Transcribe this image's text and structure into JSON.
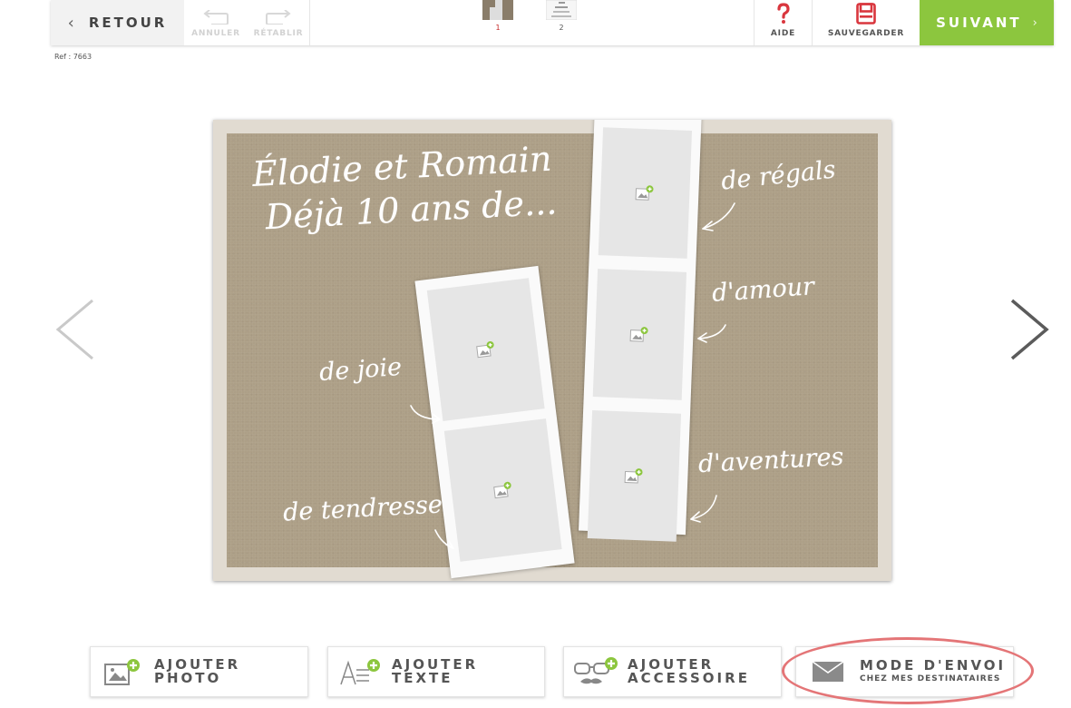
{
  "toolbar": {
    "back_label": "RETOUR",
    "undo_label": "ANNULER",
    "redo_label": "RÉTABLIR",
    "pages": [
      {
        "number": "1",
        "active": true
      },
      {
        "number": "2",
        "active": false
      }
    ],
    "help_label": "AIDE",
    "save_label": "SAUVEGARDER",
    "next_label": "SUIVANT"
  },
  "ref": "Ref : 7663",
  "card": {
    "title_line1": "Élodie et Romain",
    "title_line2": "Déjà 10 ans de...",
    "words": {
      "regals": "de régals",
      "amour": "d'amour",
      "joie": "de joie",
      "aventures": "d'aventures",
      "tendresse": "de tendresse"
    }
  },
  "bottom_bar": {
    "add_photo": "AJOUTER PHOTO",
    "add_photo_l1": "AJOUTER",
    "add_photo_l2": "PHOTO",
    "add_text_l1": "AJOUTER",
    "add_text_l2": "TEXTE",
    "add_accessory_l1": "AJOUTER",
    "add_accessory_l2": "ACCESSOIRE",
    "shipping_title": "MODE D'ENVOI",
    "shipping_sub": "CHEZ MES DESTINATAIRES"
  },
  "colors": {
    "accent_green": "#8cc63e",
    "save_red": "#d9363e",
    "kraft": "#ad9f87",
    "highlight": "#e47577"
  },
  "icons": {
    "back": "chevron-left-icon",
    "undo": "undo-arrow-icon",
    "redo": "redo-arrow-icon",
    "help": "question-mark-icon",
    "save": "floppy-disk-icon",
    "next": "chevron-right-icon",
    "add_photo": "image-plus-icon",
    "add_text": "text-plus-icon",
    "add_accessory": "glasses-mustache-plus-icon",
    "shipping": "envelope-icon"
  }
}
